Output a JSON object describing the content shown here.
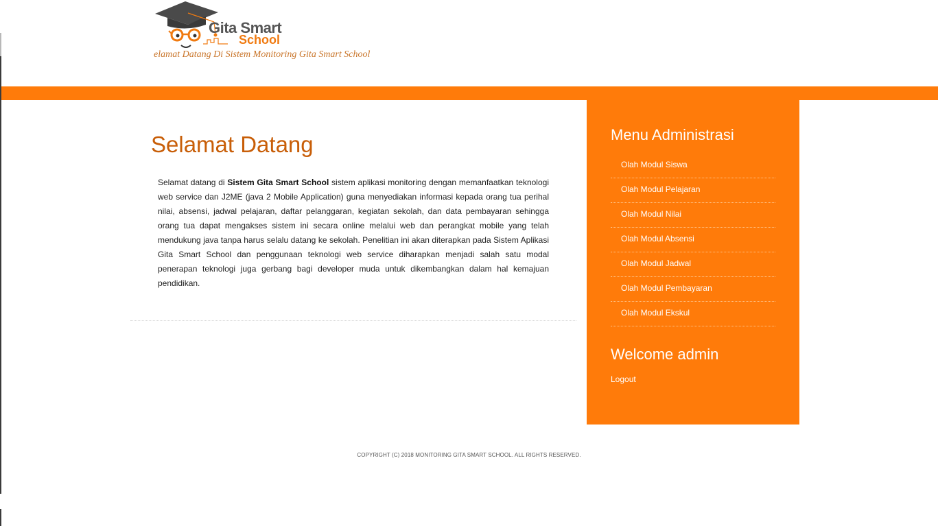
{
  "header": {
    "logo_line1": "Gita Smart",
    "logo_line2": "School",
    "tagline": "elamat Datang Di Sistem Monitoring Gita Smart School"
  },
  "main": {
    "title": "Selamat Datang",
    "intro_prefix": "Selamat datang di ",
    "intro_bold": "Sistem Gita Smart School",
    "intro_rest": " sistem aplikasi monitoring dengan memanfaatkan teknologi web service dan J2ME (java 2 Mobile Application) guna menyediakan informasi kepada orang tua perihal nilai, absensi, jadwal pelajaran, daftar pelanggaran, kegiatan sekolah, dan data pembayaran sehingga orang tua dapat mengakses sistem ini secara online melalui web dan perangkat mobile yang telah mendukung java tanpa harus selalu datang ke sekolah. Penelitian ini akan diterapkan pada Sistem Aplikasi Gita Smart School dan penggunaan teknologi web service diharapkan menjadi salah satu modal penerapan teknologi juga gerbang bagi developer muda untuk dikembangkan dalam hal kemajuan pendidikan."
  },
  "sidebar": {
    "menu_title": "Menu Administrasi",
    "items": [
      {
        "label": "Olah Modul Siswa"
      },
      {
        "label": "Olah Modul Pelajaran"
      },
      {
        "label": "Olah Modul Nilai"
      },
      {
        "label": "Olah Modul Absensi"
      },
      {
        "label": "Olah Modul Jadwal"
      },
      {
        "label": "Olah Modul Pembayaran"
      },
      {
        "label": "Olah Modul Ekskul"
      }
    ],
    "welcome": "Welcome admin",
    "logout": "Logout"
  },
  "footer": {
    "copyright": "COPYRIGHT (C) 2018 MONITORING GITA SMART SCHOOL. ALL RIGHTS RESERVED."
  },
  "colors": {
    "accent": "#ff7b0a",
    "title": "#c85e08",
    "tagline": "#c9752a"
  }
}
